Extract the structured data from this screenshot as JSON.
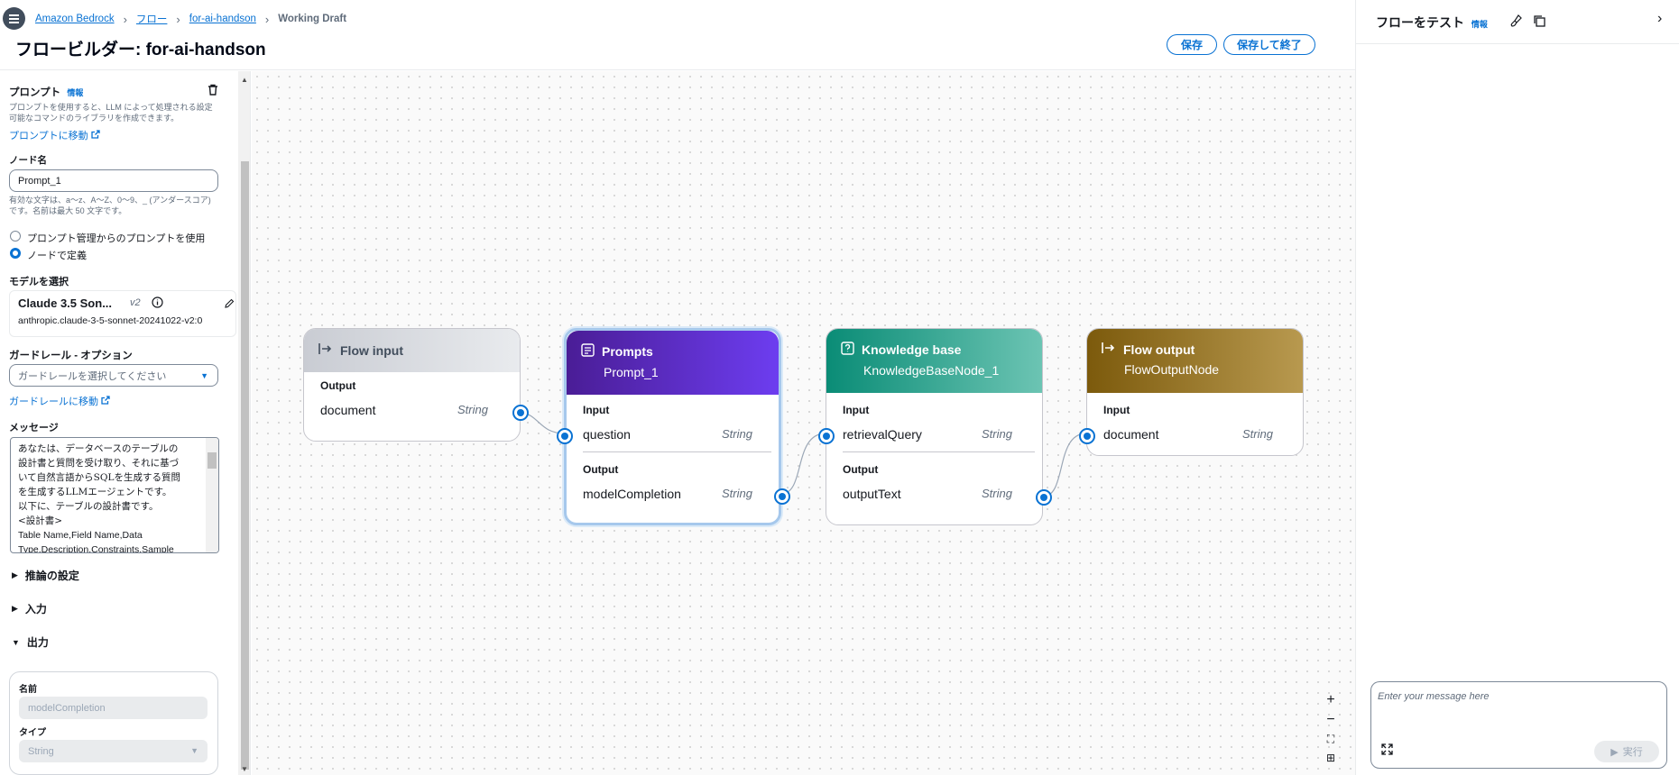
{
  "breadcrumb": {
    "items": [
      "Amazon Bedrock",
      "フロー",
      "for-ai-handson"
    ],
    "current": "Working Draft"
  },
  "page_title": "フロービルダー: for-ai-handson",
  "header_buttons": {
    "save": "保存",
    "save_exit": "保存して終了"
  },
  "left_panel": {
    "title": "プロンプト",
    "info": "情報",
    "description": "プロンプトを使用すると、LLM によって処理される設定可能なコマンドのライブラリを作成できます。",
    "go_to_prompt": "プロンプトに移動",
    "node_name_label": "ノード名",
    "node_name_value": "Prompt_1",
    "node_name_hint": "有効な文字は、a～z、A～Z、0～9、_ (アンダースコア) です。名前は最大 50 文字です。",
    "radio_use_managed": "プロンプト管理からのプロンプトを使用",
    "radio_define_in_node": "ノードで定義",
    "model_label": "モデルを選択",
    "model_name": "Claude 3.5 Son...",
    "model_version": "v2",
    "model_id": "anthropic.claude-3-5-sonnet-20241022-v2:0",
    "guardrail_label": "ガードレール - オプション",
    "guardrail_placeholder": "ガードレールを選択してください",
    "go_to_guardrail": "ガードレールに移動",
    "message_label": "メッセージ",
    "message_lines": [
      "あなたは、データベースのテーブルの",
      "設計書と質問を受け取り、それに基づ",
      "いて自然言語からSQLを生成する質問",
      "を生成するLLMエージェントです。",
      "以下に、テーブルの設計書です。",
      "<設計書>",
      "Table Name,Field Name,Data",
      "Type,Description,Constraints,Sample"
    ],
    "section_inference": "推論の設定",
    "section_input": "入力",
    "section_output": "出力",
    "output_name_label": "名前",
    "output_name_value": "modelCompletion",
    "output_type_label": "タイプ",
    "output_type_value": "String"
  },
  "nodes": {
    "flow_input": {
      "title": "Flow input",
      "output_label": "Output",
      "output_name": "document",
      "output_type": "String",
      "color": "#d9dbe0"
    },
    "prompts": {
      "title": "Prompts",
      "subtitle": "Prompt_1",
      "input_label": "Input",
      "input_name": "question",
      "input_type": "String",
      "output_label": "Output",
      "output_name": "modelCompletion",
      "output_type": "String",
      "color": "#5b21b6"
    },
    "knowledge_base": {
      "title": "Knowledge base",
      "subtitle": "KnowledgeBaseNode_1",
      "input_label": "Input",
      "input_name": "retrievalQuery",
      "input_type": "String",
      "output_label": "Output",
      "output_name": "outputText",
      "output_type": "String",
      "color": "#0f9b83"
    },
    "flow_output": {
      "title": "Flow output",
      "subtitle": "FlowOutputNode",
      "input_label": "Input",
      "input_name": "document",
      "input_type": "String",
      "color": "#8a6a1a"
    }
  },
  "canvas_controls": [
    "+",
    "−",
    "⛶",
    "⊞"
  ],
  "right_panel": {
    "title": "フローをテスト",
    "info": "情報",
    "chat_placeholder": "Enter your message here",
    "run_button": "実行"
  }
}
